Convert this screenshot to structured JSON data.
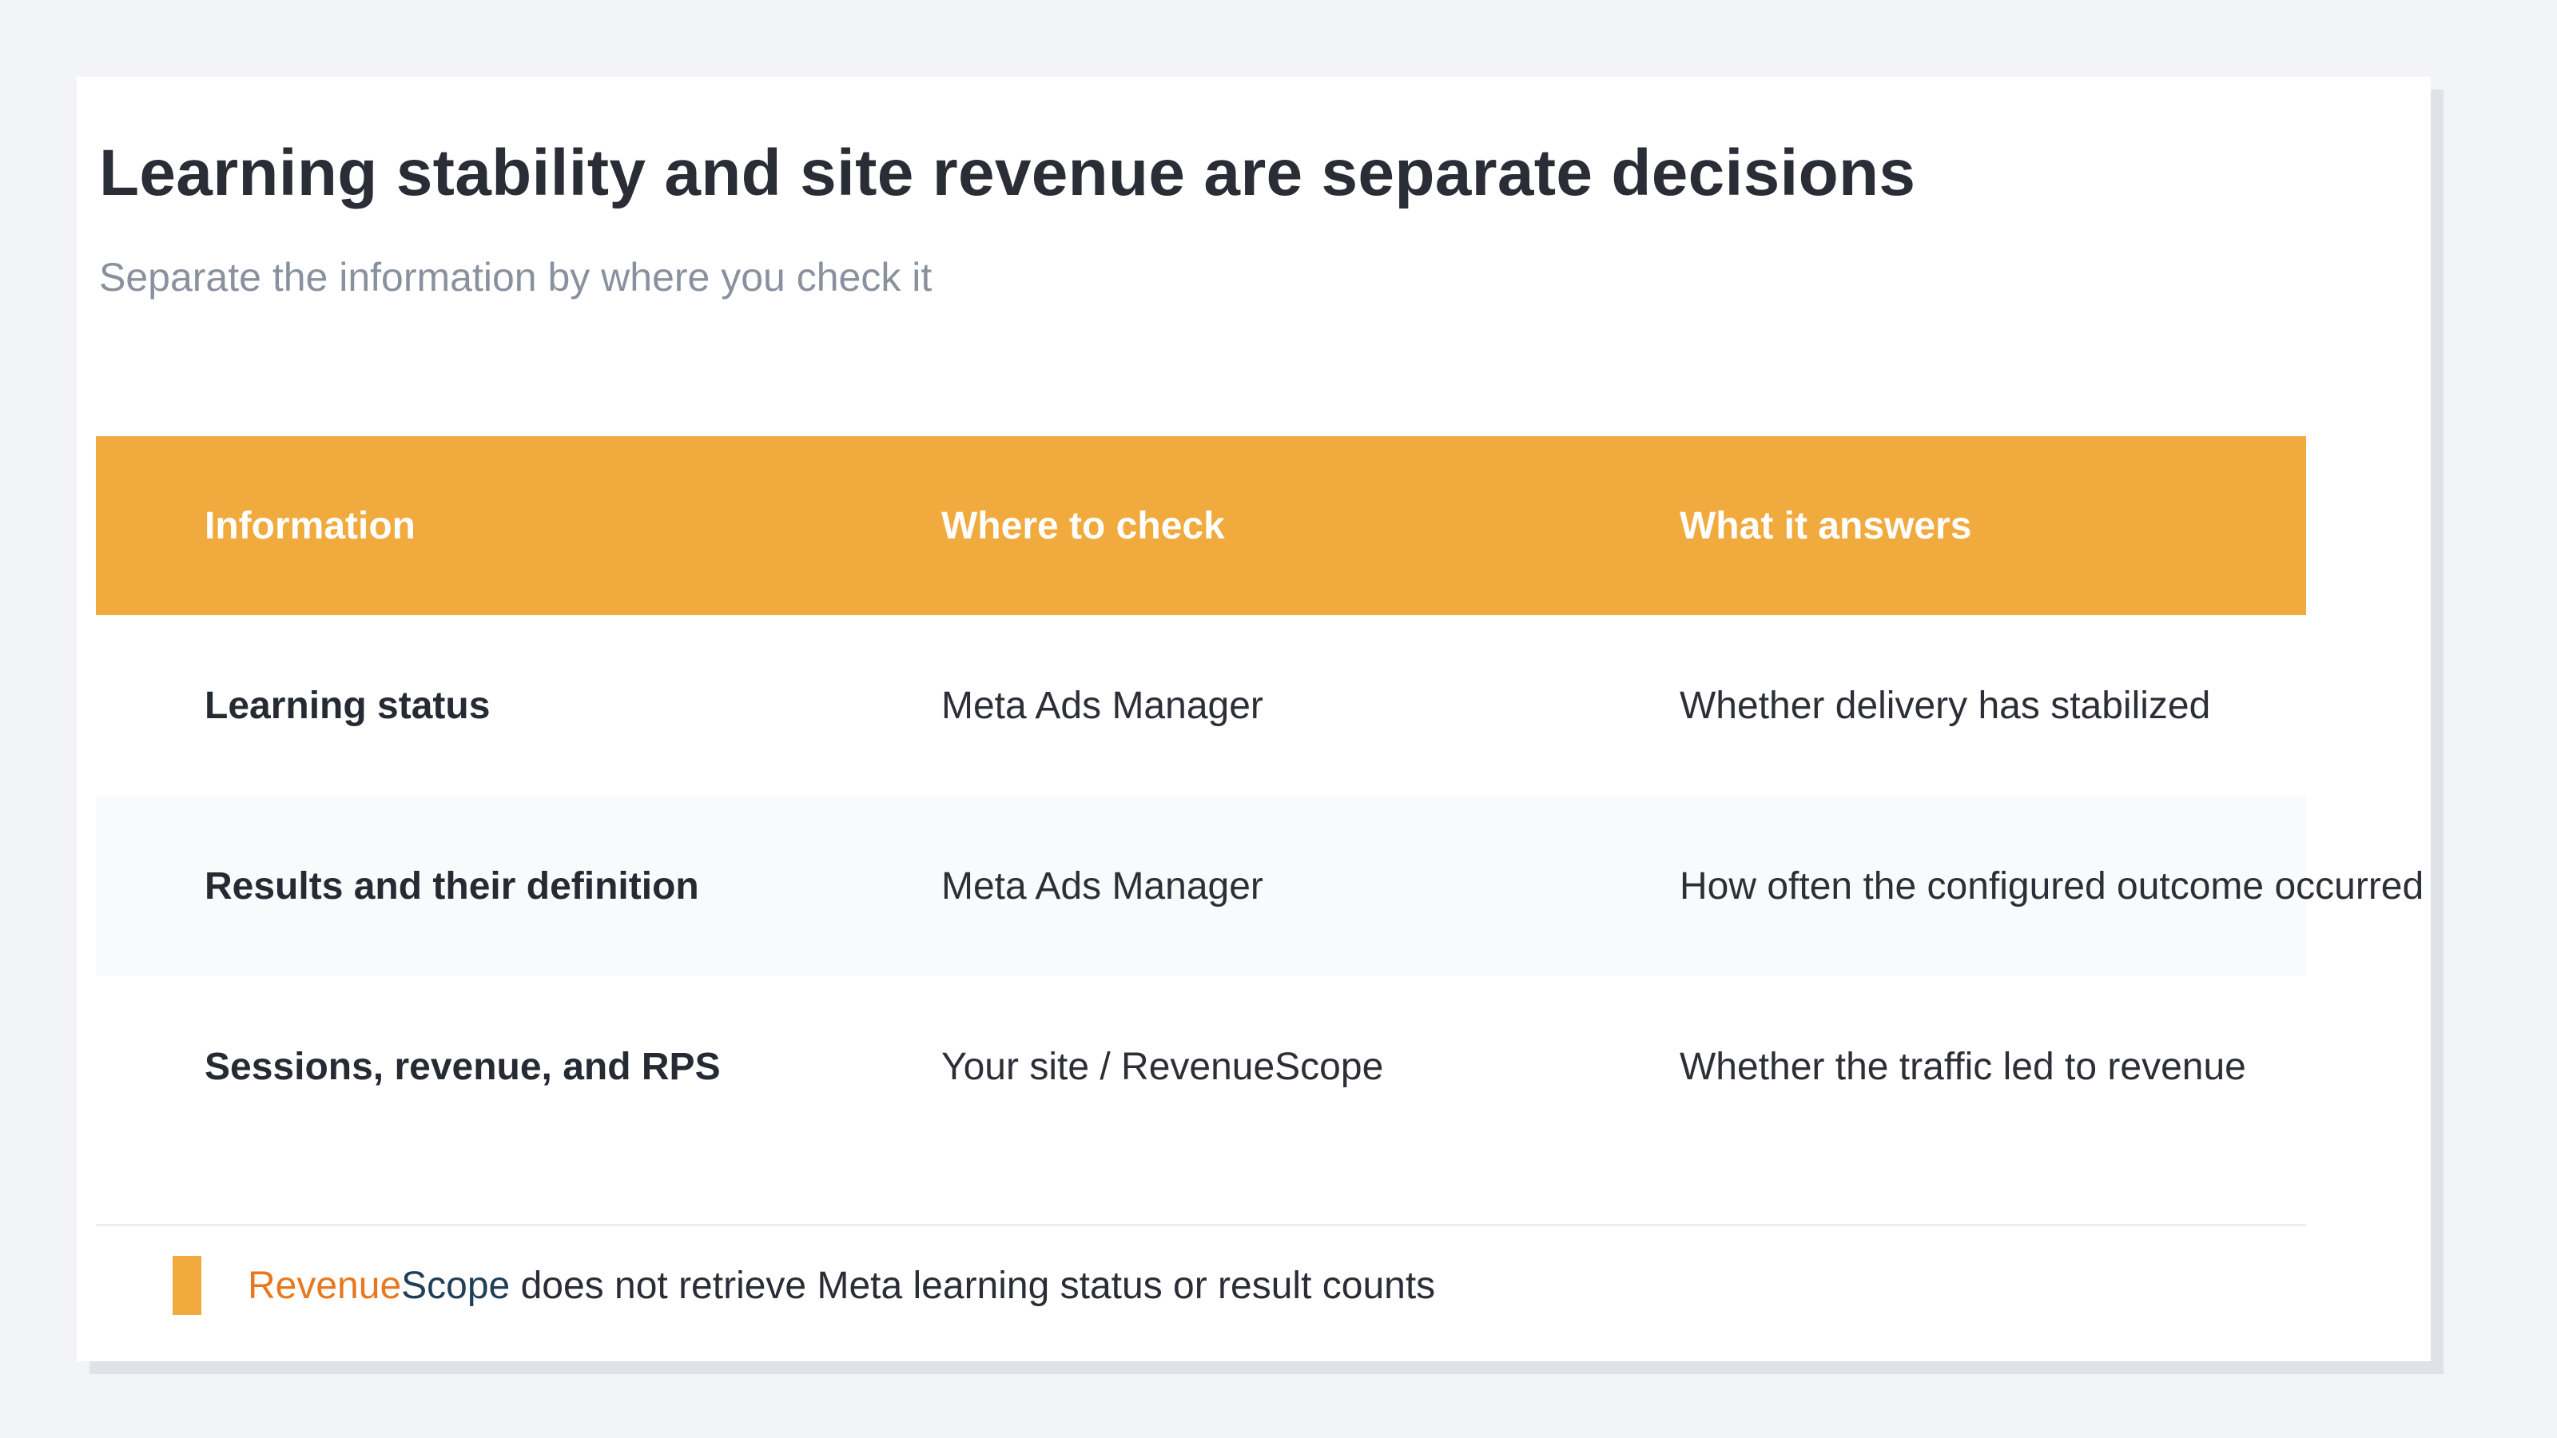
{
  "slide": {
    "title": "Learning stability and site revenue are separate decisions",
    "subtitle": "Separate the information by where you check it"
  },
  "table": {
    "columns": [
      "Information",
      "Where to check",
      "What it answers"
    ],
    "rows": [
      {
        "information": "Learning status",
        "where": "Meta Ads Manager",
        "answers": "Whether delivery has stabilized"
      },
      {
        "information": "Results and their definition",
        "where": "Meta Ads Manager",
        "answers": "How often the configured outcome occurred"
      },
      {
        "information": "Sessions, revenue, and RPS",
        "where": "Your site / RevenueScope",
        "answers": "Whether the traffic led to revenue"
      }
    ]
  },
  "footnote": {
    "brand_part1": "Revenue",
    "brand_part2": "Scope",
    "text": " does not retrieve Meta learning status or result counts"
  },
  "colors": {
    "accent": "#f0aa3d",
    "brand_orange": "#e8781e",
    "brand_navy": "#1f3f57"
  }
}
